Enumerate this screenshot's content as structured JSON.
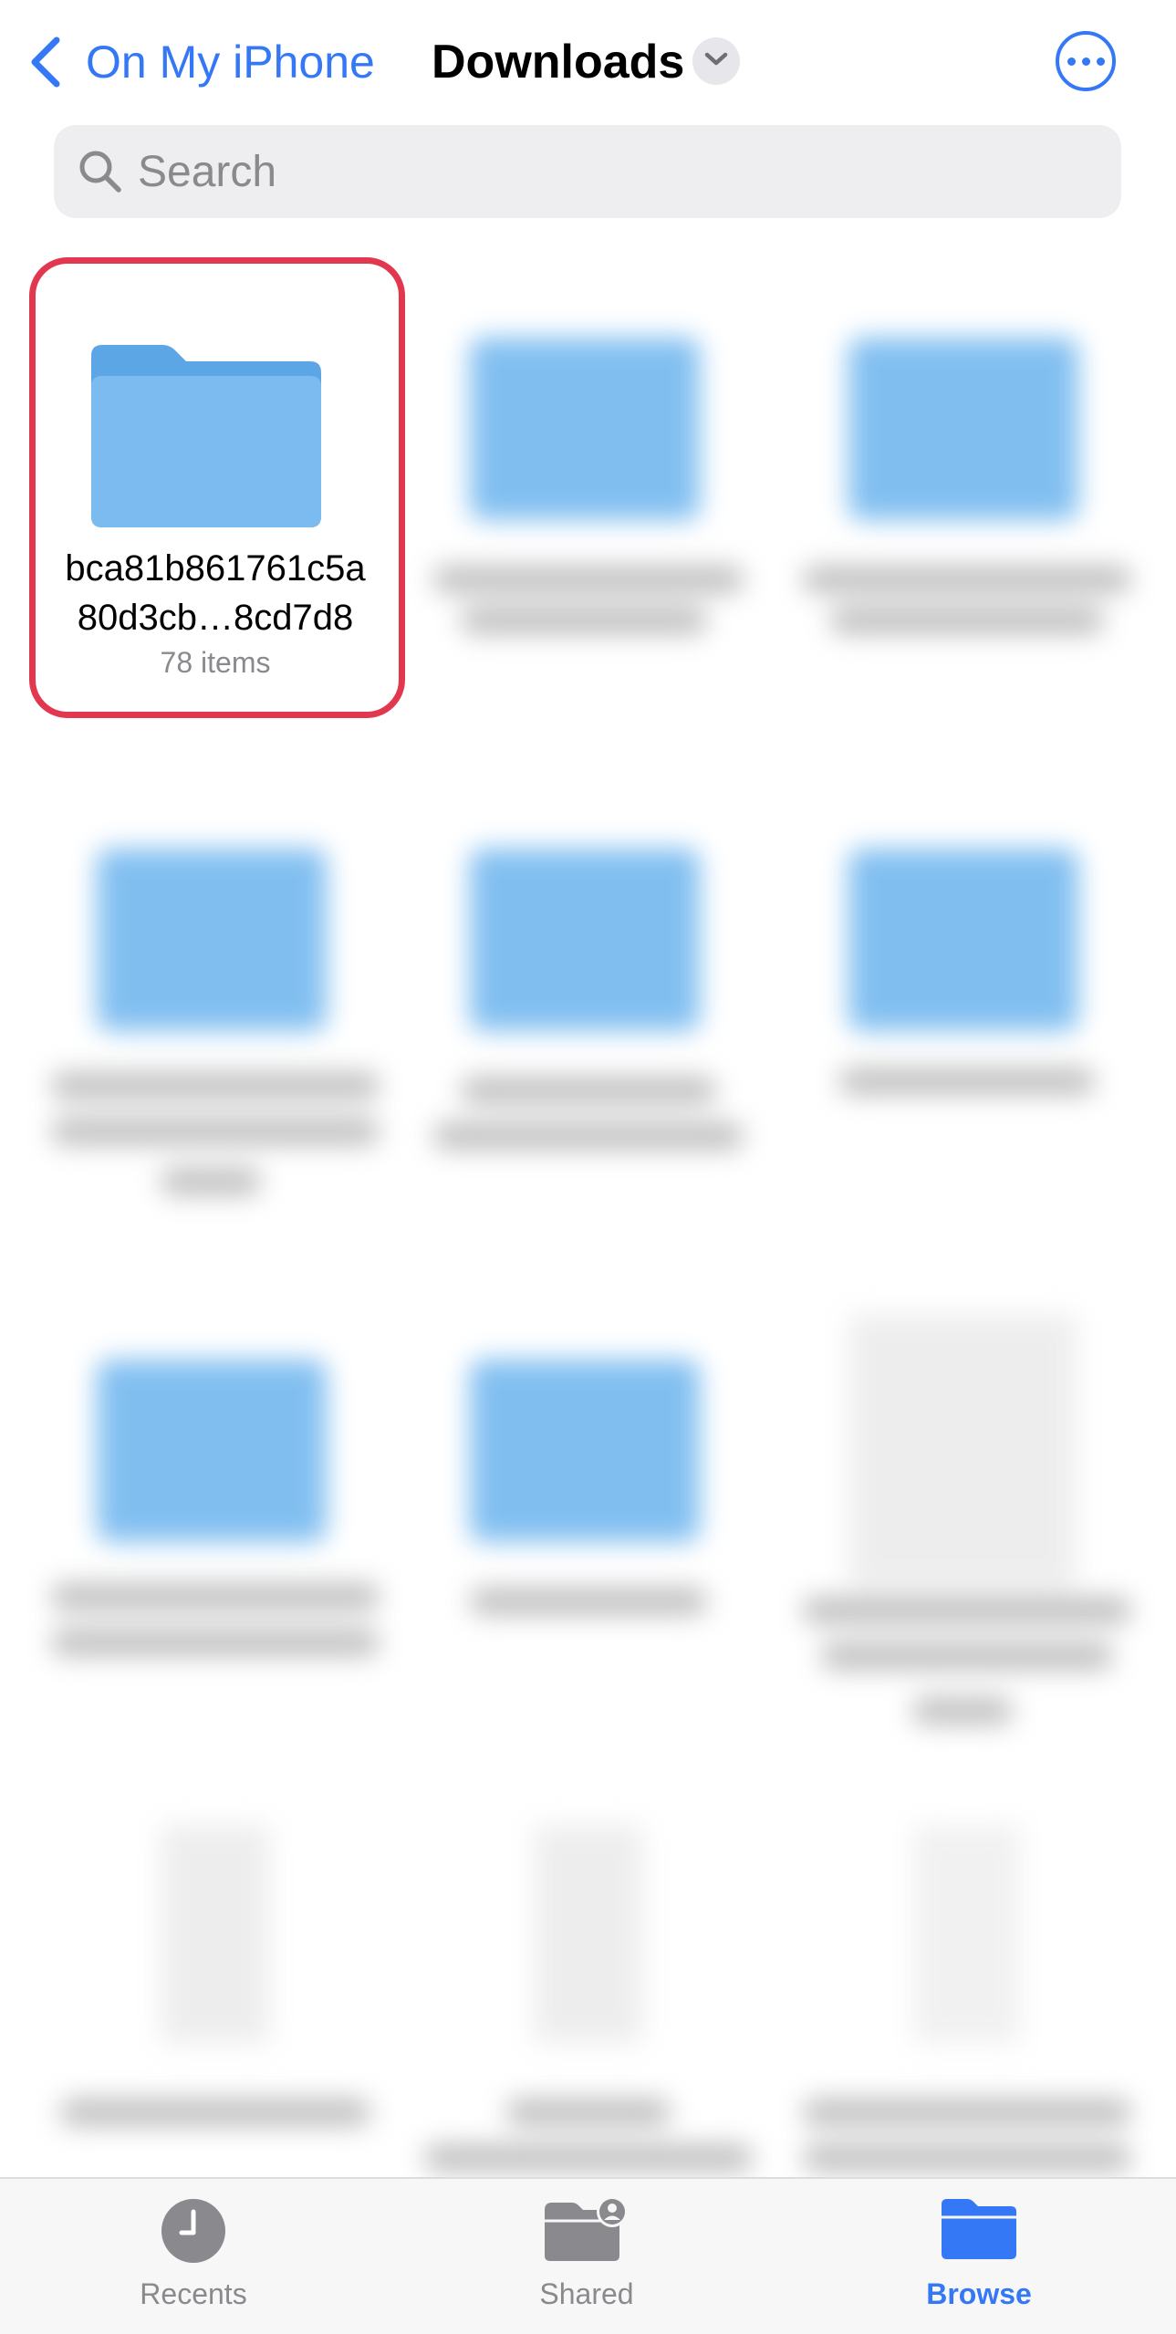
{
  "nav": {
    "back_label": "On My iPhone",
    "title": "Downloads"
  },
  "search": {
    "placeholder": "Search"
  },
  "focused_item": {
    "name_line1": "bca81b861761c5a",
    "name_line2": "80d3cb…8cd7d8",
    "count": "78 items"
  },
  "tabs": [
    {
      "label": "Recents",
      "icon": "clock-icon"
    },
    {
      "label": "Shared",
      "icon": "shared-folder-icon"
    },
    {
      "label": "Browse",
      "icon": "folder-icon"
    }
  ],
  "colors": {
    "accent": "#3478f6",
    "highlight": "#e2384f",
    "folder_blue": "#74b8ef"
  }
}
